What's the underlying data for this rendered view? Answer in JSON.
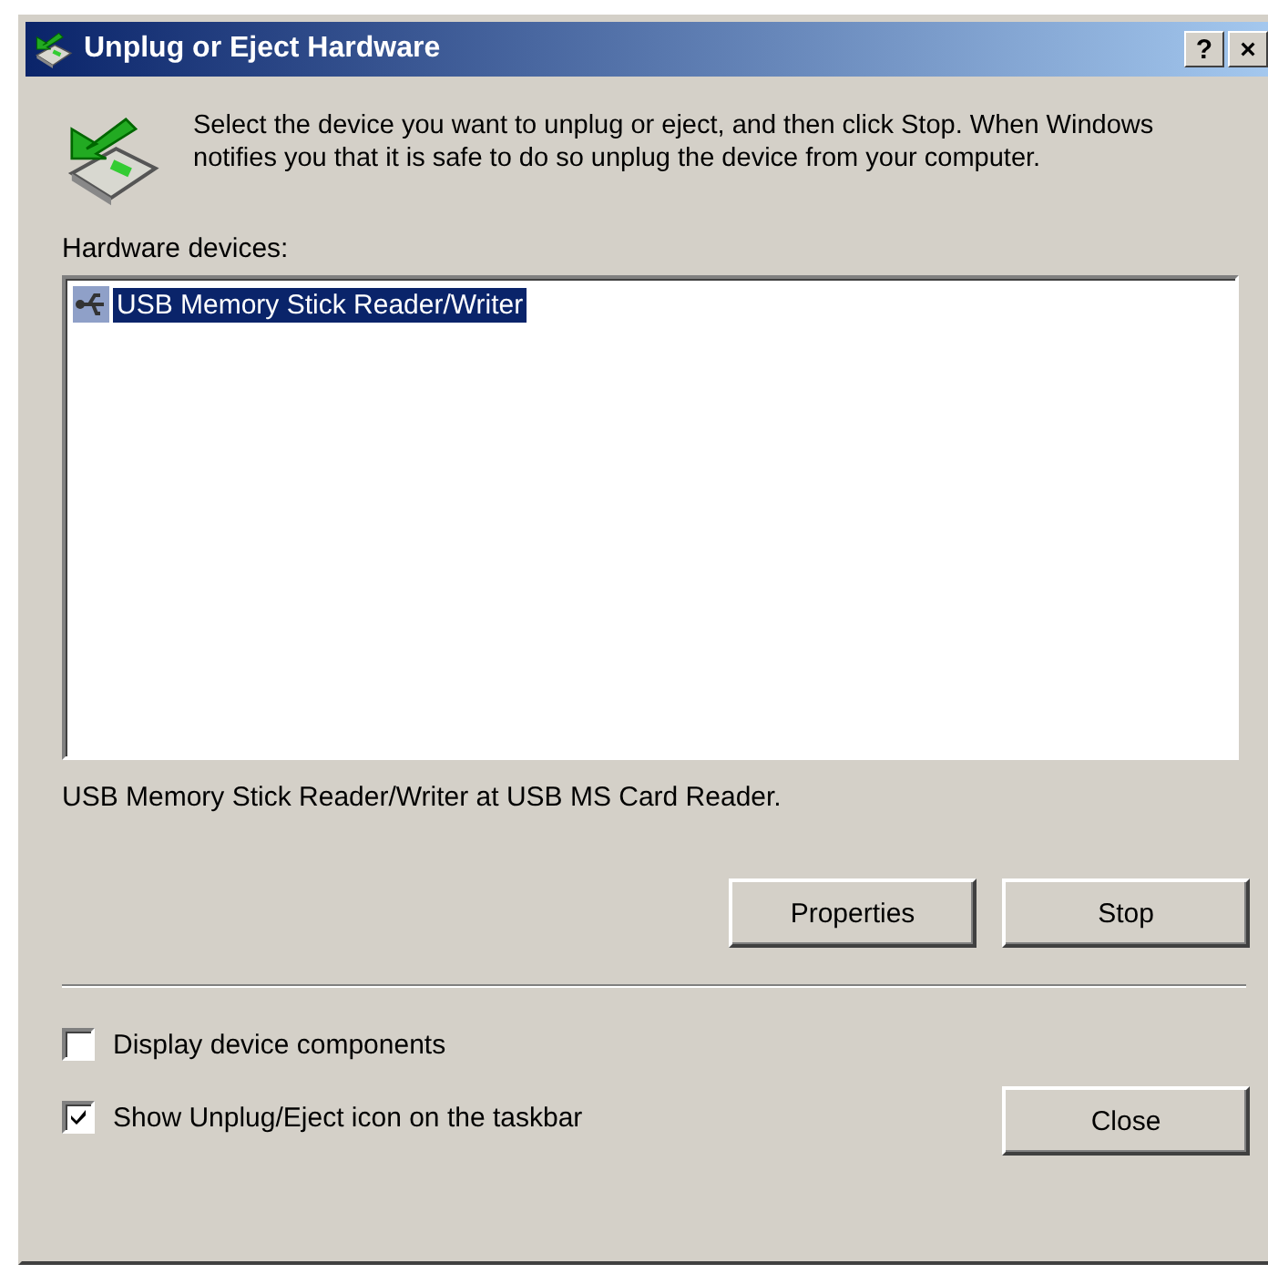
{
  "window": {
    "title": "Unplug or Eject Hardware",
    "title_buttons": [
      "?",
      "×"
    ]
  },
  "instruction": "Select the device you want to unplug or eject, and then click Stop. When Windows notifies you that it is safe to do so unplug the device from your computer.",
  "devices_label": "Hardware devices:",
  "devices": [
    {
      "label": "USB Memory Stick Reader/Writer",
      "selected": true
    }
  ],
  "device_description": "USB Memory Stick Reader/Writer at USB MS Card Reader.",
  "buttons": [
    "Properties",
    "Stop"
  ],
  "options": [
    {
      "label": "Display device components",
      "checked": false
    },
    {
      "label": "Show Unplug/Eject icon on the taskbar",
      "checked": true
    }
  ],
  "close_button": "Close"
}
